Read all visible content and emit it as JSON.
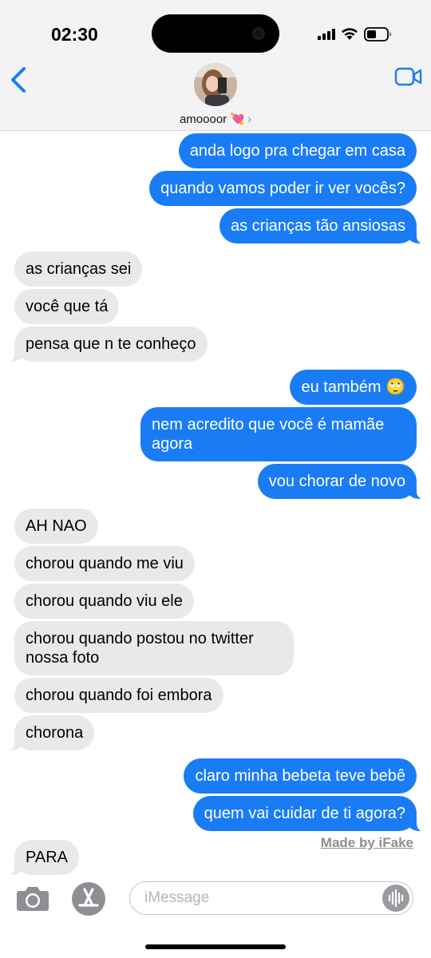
{
  "status": {
    "time": "02:30"
  },
  "contact": {
    "name": "amoooor",
    "emoji": "💘",
    "chevron": "›"
  },
  "messages": [
    {
      "dir": "sent",
      "text": "anda logo pra chegar em casa"
    },
    {
      "dir": "sent",
      "text": "quando vamos poder ir ver vocês?"
    },
    {
      "dir": "sent",
      "text": "as crianças tão ansiosas"
    },
    {
      "dir": "recv",
      "text": "as crianças sei"
    },
    {
      "dir": "recv",
      "text": "você que tá"
    },
    {
      "dir": "recv",
      "text": "pensa que n te conheço"
    },
    {
      "dir": "sent",
      "text": "eu também 🙄"
    },
    {
      "dir": "sent",
      "text": "nem acredito que você é mamãe agora"
    },
    {
      "dir": "sent",
      "text": "vou chorar de novo"
    },
    {
      "dir": "recv",
      "text": "AH NAO"
    },
    {
      "dir": "recv",
      "text": "chorou quando me viu"
    },
    {
      "dir": "recv",
      "text": "chorou quando viu ele"
    },
    {
      "dir": "recv",
      "text": "chorou quando postou no twitter nossa foto"
    },
    {
      "dir": "recv",
      "text": "chorou quando foi embora"
    },
    {
      "dir": "recv",
      "text": "chorona"
    },
    {
      "dir": "sent",
      "text": "claro minha bebeta teve bebê"
    },
    {
      "dir": "sent",
      "text": "quem vai cuidar de ti agora?"
    },
    {
      "dir": "recv",
      "text": "PARA"
    }
  ],
  "watermark": "Made by iFake",
  "input": {
    "placeholder": "iMessage"
  },
  "colors": {
    "sent": "#1a7cf5",
    "received": "#e9e9eb",
    "accent": "#1a7cf5"
  },
  "icons": {
    "back": "chevron-left-icon",
    "video": "video-camera-icon",
    "camera": "camera-icon",
    "apps": "app-store-icon",
    "audio": "waveform-icon"
  }
}
